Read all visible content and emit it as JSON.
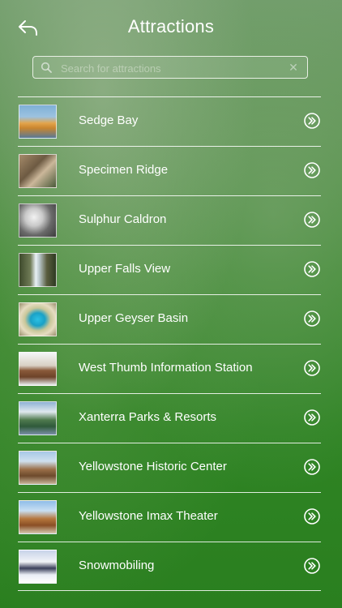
{
  "header": {
    "title": "Attractions"
  },
  "search": {
    "placeholder": "Search for attractions",
    "value": ""
  },
  "items": [
    {
      "label": "Sedge Bay"
    },
    {
      "label": "Specimen Ridge"
    },
    {
      "label": "Sulphur Caldron"
    },
    {
      "label": "Upper Falls View"
    },
    {
      "label": "Upper Geyser Basin"
    },
    {
      "label": "West Thumb Information Station"
    },
    {
      "label": "Xanterra Parks & Resorts"
    },
    {
      "label": "Yellowstone Historic Center"
    },
    {
      "label": "Yellowstone Imax Theater"
    },
    {
      "label": "Snowmobiling"
    }
  ],
  "icons": {
    "back": "back-arrow-icon",
    "search": "search-icon",
    "clear": "clear-icon",
    "row_action": "double-chevron-right-icon"
  },
  "colors": {
    "accent_text": "#ffffff",
    "background_top": "#6f9c69",
    "background_bottom": "#2a7f1f"
  }
}
